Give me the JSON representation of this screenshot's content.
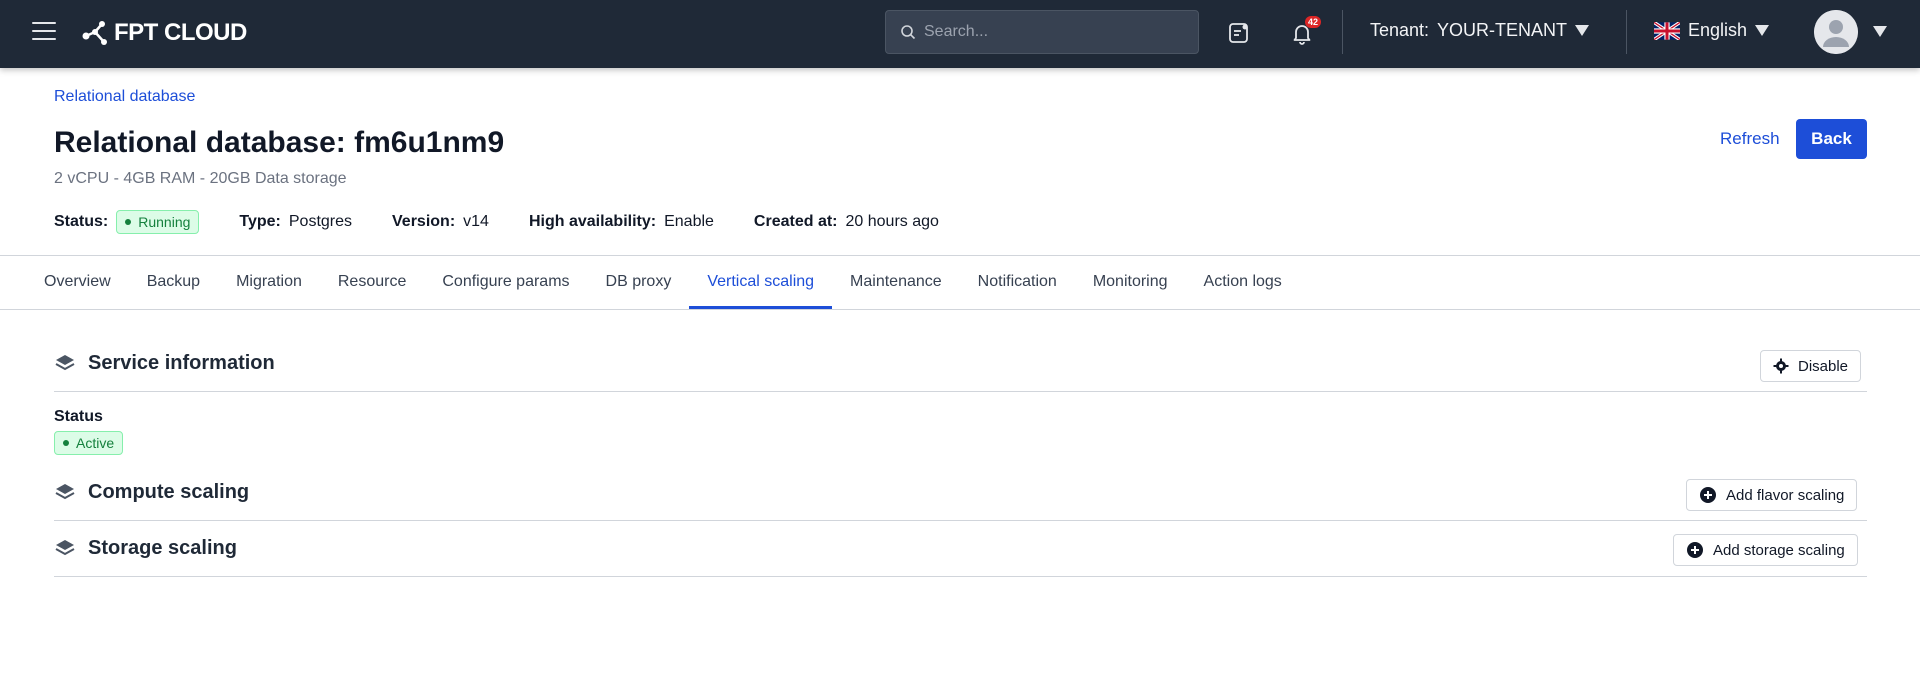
{
  "topbar": {
    "brand": "FPT CLOUD",
    "search_placeholder": "Search...",
    "notification_count": "42",
    "tenant_label": "Tenant:",
    "tenant_value": "YOUR-TENANT",
    "language": "English"
  },
  "header": {
    "breadcrumb": "Relational database",
    "title": "Relational database: fm6u1nm9",
    "subtitle": "2 vCPU - 4GB RAM - 20GB Data storage",
    "refresh_label": "Refresh",
    "back_label": "Back"
  },
  "meta": {
    "status_label": "Status:",
    "status_value": "Running",
    "type_label": "Type:",
    "type_value": "Postgres",
    "version_label": "Version:",
    "version_value": "v14",
    "ha_label": "High availability:",
    "ha_value": "Enable",
    "created_label": "Created at:",
    "created_value": "20 hours ago"
  },
  "tabs": [
    {
      "label": "Overview"
    },
    {
      "label": "Backup"
    },
    {
      "label": "Migration"
    },
    {
      "label": "Resource"
    },
    {
      "label": "Configure params"
    },
    {
      "label": "DB proxy"
    },
    {
      "label": "Vertical scaling",
      "active": true
    },
    {
      "label": "Maintenance"
    },
    {
      "label": "Notification"
    },
    {
      "label": "Monitoring"
    },
    {
      "label": "Action logs"
    }
  ],
  "service_info": {
    "title": "Service information",
    "disable_label": "Disable",
    "status_label": "Status",
    "status_value": "Active"
  },
  "compute_scaling": {
    "title": "Compute scaling",
    "button_label": "Add flavor scaling"
  },
  "storage_scaling": {
    "title": "Storage scaling",
    "button_label": "Add storage scaling"
  },
  "colors": {
    "topbar_bg": "#1f2937",
    "primary": "#1d4ed8",
    "status_green": "#15803d"
  }
}
